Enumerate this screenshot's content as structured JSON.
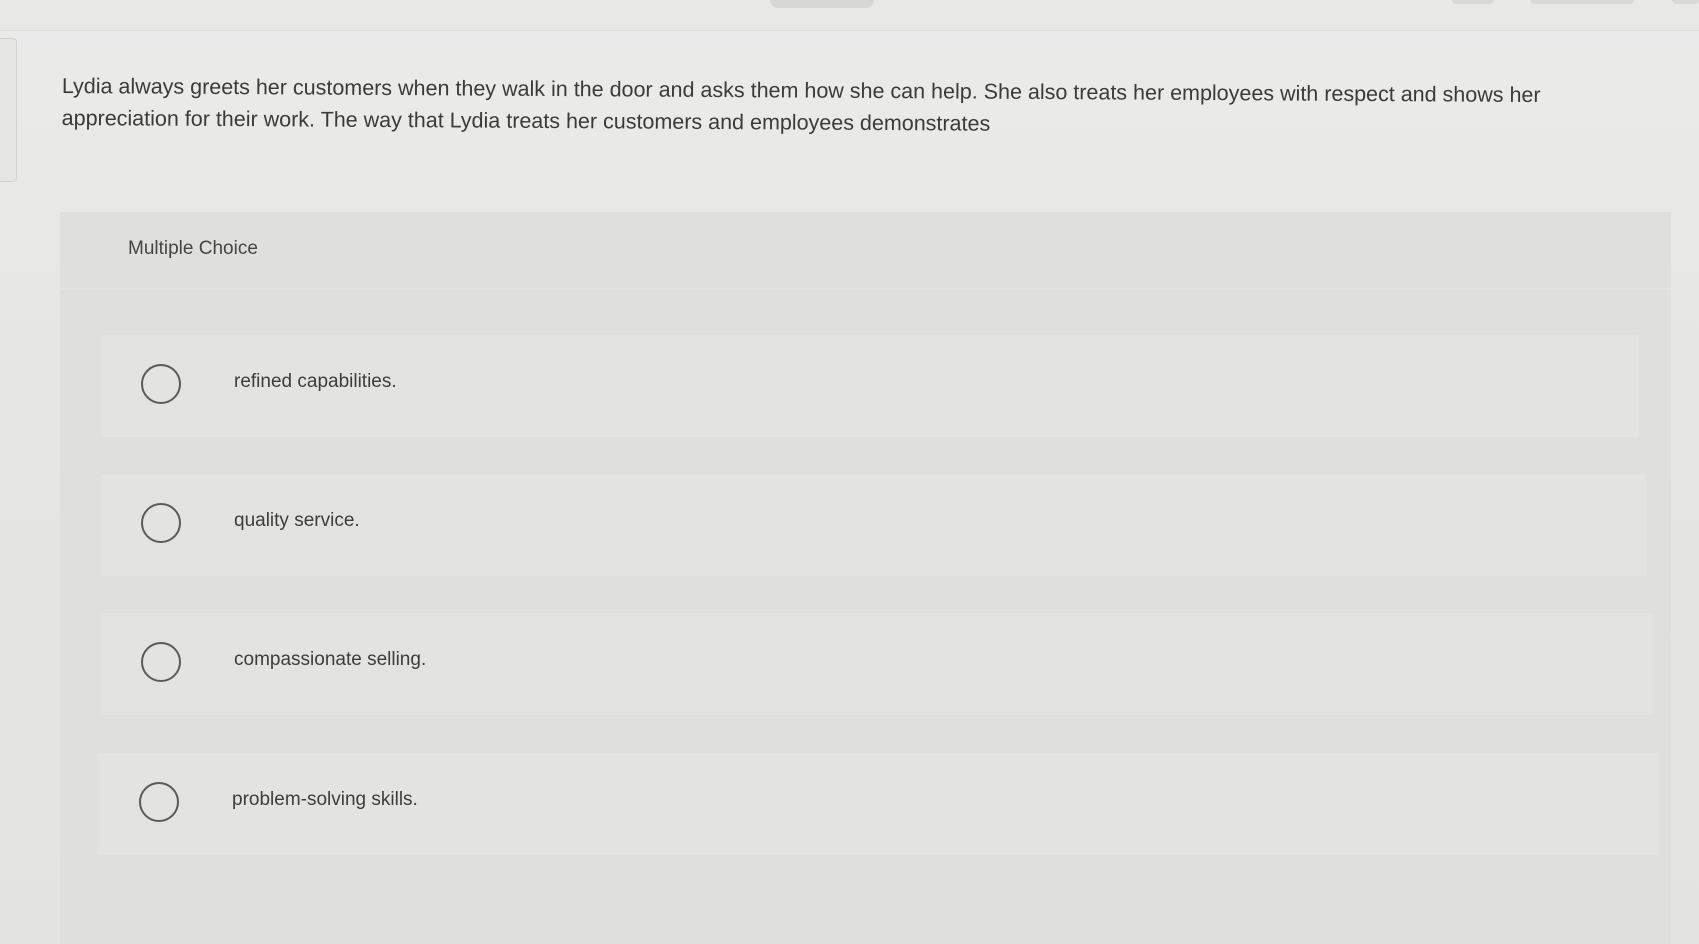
{
  "question": {
    "text": "Lydia always greets her customers when they walk in the door and asks them how she can help. She also treats her employees with respect and shows her appreciation for their work. The way that Lydia treats her customers and employees demonstrates"
  },
  "multiple_choice": {
    "label": "Multiple Choice",
    "options": [
      {
        "label": "refined capabilities.",
        "selected": false
      },
      {
        "label": "quality service.",
        "selected": false
      },
      {
        "label": "compassionate selling.",
        "selected": false
      },
      {
        "label": "problem-solving skills.",
        "selected": false
      }
    ]
  },
  "colors": {
    "background": "#e4e4e2",
    "panel": "#dfdfdd",
    "option_row": "#e3e3e1",
    "text": "#3b3b3b"
  }
}
